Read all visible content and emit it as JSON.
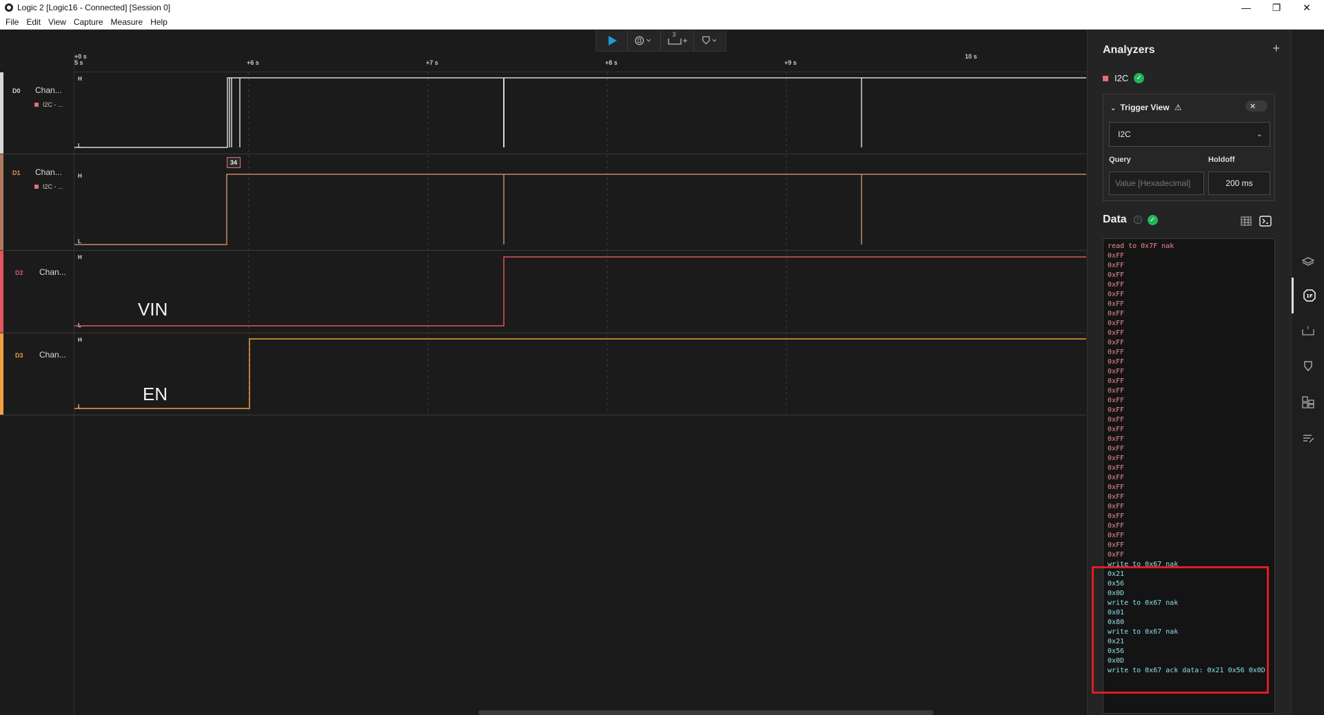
{
  "window": {
    "title": "Logic 2 [Logic16 - Connected] [Session 0]"
  },
  "menu": [
    "File",
    "Edit",
    "View",
    "Capture",
    "Measure",
    "Help"
  ],
  "toolbar": {
    "timing_label": "3"
  },
  "ruler": {
    "origin_top": "+0 s",
    "origin_bottom": "5 s",
    "ticks": [
      "+6 s",
      "+7 s",
      "+8 s",
      "+9 s",
      "10 s"
    ]
  },
  "channels": [
    {
      "id": "D0",
      "name": "Chan...",
      "sub": "I2C - ...",
      "color": "#d8d8d8",
      "id_color": "#d8d8d8",
      "high": "H",
      "low": "L"
    },
    {
      "id": "D1",
      "name": "Chan...",
      "sub": "I2C - ...",
      "color": "#b07a5f",
      "id_color": "#e0925a",
      "high": "H",
      "low": "L",
      "marker": "34"
    },
    {
      "id": "D2",
      "name": "Chan...",
      "color": "#e05561",
      "id_color": "#e05561",
      "high": "H",
      "low": "L",
      "annotation": "VIN"
    },
    {
      "id": "D3",
      "name": "Chan...",
      "color": "#f0a040",
      "id_color": "#f0a040",
      "high": "H",
      "low": "L",
      "annotation": "EN"
    }
  ],
  "sidebar": {
    "analyzers_title": "Analyzers",
    "add_symbol": "+",
    "analyzer_name": "I2C",
    "trigger": {
      "title": "Trigger View",
      "warning": "⚠",
      "close": "✕",
      "selected": "I2C",
      "query_label": "Query",
      "holdoff_label": "Holdoff",
      "query_placeholder": "Value [Hexadecimal]",
      "holdoff_value": "200 ms"
    },
    "data_title": "Data",
    "help_symbol": "?",
    "terminal_lines": [
      {
        "t": "read to 0x7F nak",
        "c": "red"
      },
      {
        "t": "0xFF",
        "c": "red"
      },
      {
        "t": "0xFF",
        "c": "red"
      },
      {
        "t": "0xFF",
        "c": "red"
      },
      {
        "t": "0xFF",
        "c": "red"
      },
      {
        "t": "0xFF",
        "c": "red"
      },
      {
        "t": "0xFF",
        "c": "red"
      },
      {
        "t": "0xFF",
        "c": "red"
      },
      {
        "t": "0xFF",
        "c": "red"
      },
      {
        "t": "0xFF",
        "c": "red"
      },
      {
        "t": "0xFF",
        "c": "red"
      },
      {
        "t": "0xFF",
        "c": "red"
      },
      {
        "t": "0xFF",
        "c": "red"
      },
      {
        "t": "0xFF",
        "c": "red"
      },
      {
        "t": "0xFF",
        "c": "red"
      },
      {
        "t": "0xFF",
        "c": "red"
      },
      {
        "t": "0xFF",
        "c": "red"
      },
      {
        "t": "0xFF",
        "c": "red"
      },
      {
        "t": "0xFF",
        "c": "red"
      },
      {
        "t": "0xFF",
        "c": "red"
      },
      {
        "t": "0xFF",
        "c": "red"
      },
      {
        "t": "0xFF",
        "c": "red"
      },
      {
        "t": "0xFF",
        "c": "red"
      },
      {
        "t": "0xFF",
        "c": "red"
      },
      {
        "t": "0xFF",
        "c": "red"
      },
      {
        "t": "0xFF",
        "c": "red"
      },
      {
        "t": "0xFF",
        "c": "red"
      },
      {
        "t": "0xFF",
        "c": "red"
      },
      {
        "t": "0xFF",
        "c": "red"
      },
      {
        "t": "0xFF",
        "c": "red"
      },
      {
        "t": "0xFF",
        "c": "red"
      },
      {
        "t": "0xFF",
        "c": "red"
      },
      {
        "t": "0xFF",
        "c": "red"
      },
      {
        "t": "write to 0x67 nak",
        "c": "cyan"
      },
      {
        "t": "0x21",
        "c": "cyan"
      },
      {
        "t": "0x56",
        "c": "cyan"
      },
      {
        "t": "0x0D",
        "c": "cyan"
      },
      {
        "t": "write to 0x67 nak",
        "c": "cyan"
      },
      {
        "t": "0x01",
        "c": "cyan"
      },
      {
        "t": "0x80",
        "c": "cyan"
      },
      {
        "t": "write to 0x67 nak",
        "c": "cyan"
      },
      {
        "t": "0x21",
        "c": "cyan"
      },
      {
        "t": "0x56",
        "c": "cyan"
      },
      {
        "t": "0x0D",
        "c": "cyan"
      },
      {
        "t": "write to 0x67 ack data: 0x21 0x56 0x0D",
        "c": "cyan"
      }
    ]
  },
  "icons": {
    "toolbar": [
      "play-icon",
      "trigger-icon",
      "timing-marker-icon",
      "marker-icon"
    ],
    "rail": [
      "layers-icon",
      "analyzer-icon",
      "timing-icon",
      "marker-icon",
      "extensions-icon",
      "notes-icon"
    ]
  },
  "colors": {
    "accent": "#1e9bd7",
    "success": "#22b35b",
    "highlight": "#e01c24"
  }
}
